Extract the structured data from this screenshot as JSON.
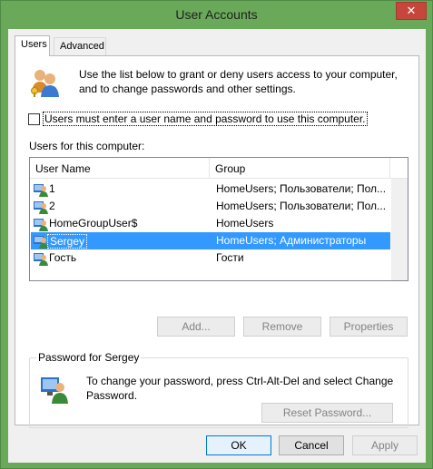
{
  "window": {
    "title": "User Accounts",
    "close_glyph": "✕"
  },
  "tabs": [
    {
      "label": "Users",
      "active": true
    },
    {
      "label": "Advanced",
      "active": false
    }
  ],
  "users_tab": {
    "intro_text": "Use the list below to grant or deny users access to your computer, and to change passwords and other settings.",
    "require_login_checkbox": {
      "label": "Users must enter a user name and password to use this computer.",
      "checked": false
    },
    "list_caption": "Users for this computer:",
    "columns": [
      "User Name",
      "Group"
    ],
    "users": [
      {
        "name": "1",
        "group": "HomeUsers; Пользователи; Пол...",
        "selected": false
      },
      {
        "name": "2",
        "group": "HomeUsers; Пользователи; Пол...",
        "selected": false
      },
      {
        "name": "HomeGroupUser$",
        "group": "HomeUsers",
        "selected": false
      },
      {
        "name": "Sergey",
        "group": "HomeUsers; Администраторы",
        "selected": true
      },
      {
        "name": "Гость",
        "group": "Гости",
        "selected": false
      }
    ],
    "buttons": {
      "add": "Add...",
      "remove": "Remove",
      "properties": "Properties"
    },
    "password_group": {
      "title": "Password for Sergey",
      "text": "To change your password, press Ctrl-Alt-Del and select Change Password.",
      "reset_button": "Reset Password..."
    }
  },
  "dialog_buttons": {
    "ok": "OK",
    "cancel": "Cancel",
    "apply": "Apply"
  },
  "colors": {
    "frame": "#6aa95a",
    "selection": "#3399ff",
    "close": "#c7463c"
  }
}
